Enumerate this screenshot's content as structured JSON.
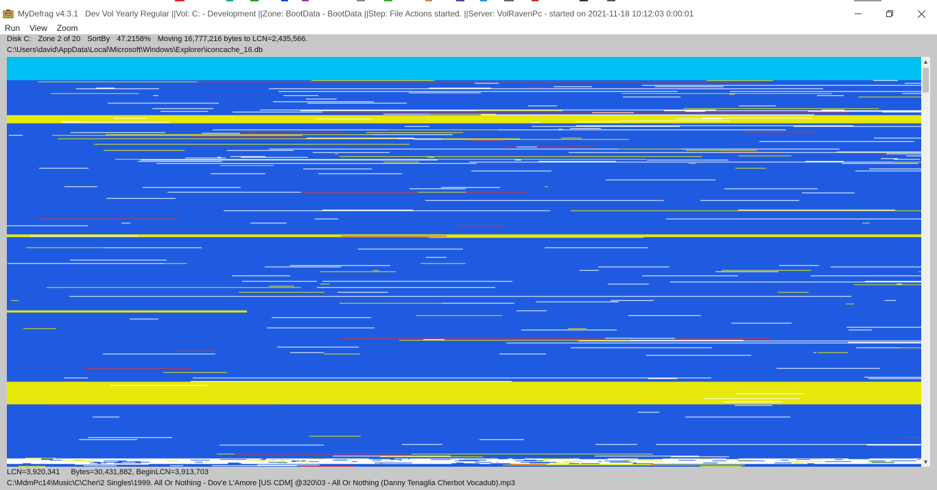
{
  "window": {
    "app_name": "MyDefrag v4.3.1",
    "title_details": "Dev Vol Yearly Regular ||Vol: C: - Development ||Zone: BootData - BootData ||Step: File Actions started. ||Server: VolRavenPc -  started on 2021-11-18 10:12:03 0:00:01",
    "minimize_icon": "minimize-icon",
    "restore_icon": "restore-icon",
    "close_icon": "close-icon"
  },
  "menu": {
    "items": [
      "Run",
      "View",
      "Zoom"
    ]
  },
  "status": {
    "disk": "Disk C:",
    "zone": "Zone 2 of 20",
    "sortby": "SortBy",
    "percent": "47.2158%",
    "action": "Moving 16,777,216 bytes to LCN=2,435,566.",
    "current_file": "C:\\Users\\david\\AppData\\Local\\Microsoft\\Windows\\Explorer\\iconcache_16.db"
  },
  "footer": {
    "lcn": "LCN=3,920,341",
    "bytes": "Bytes=30,431,882, BeginLCN=3,913,703",
    "hover_file": "C:\\MdmPc14\\Music\\C\\Cher\\2 Singles\\1999. All Or Nothing - Dov'e L'Amore [US CDM] @320\\03 - All Or Nothing (Danny Tenaglia Cherbot Vocadub).mp3"
  },
  "colors": {
    "map_background": "#1e5be0",
    "boot_zone": "#00bff3",
    "file_fragment": "#e8e80a",
    "free_space": "#ffffff",
    "client_background": "#c8c8c8"
  }
}
